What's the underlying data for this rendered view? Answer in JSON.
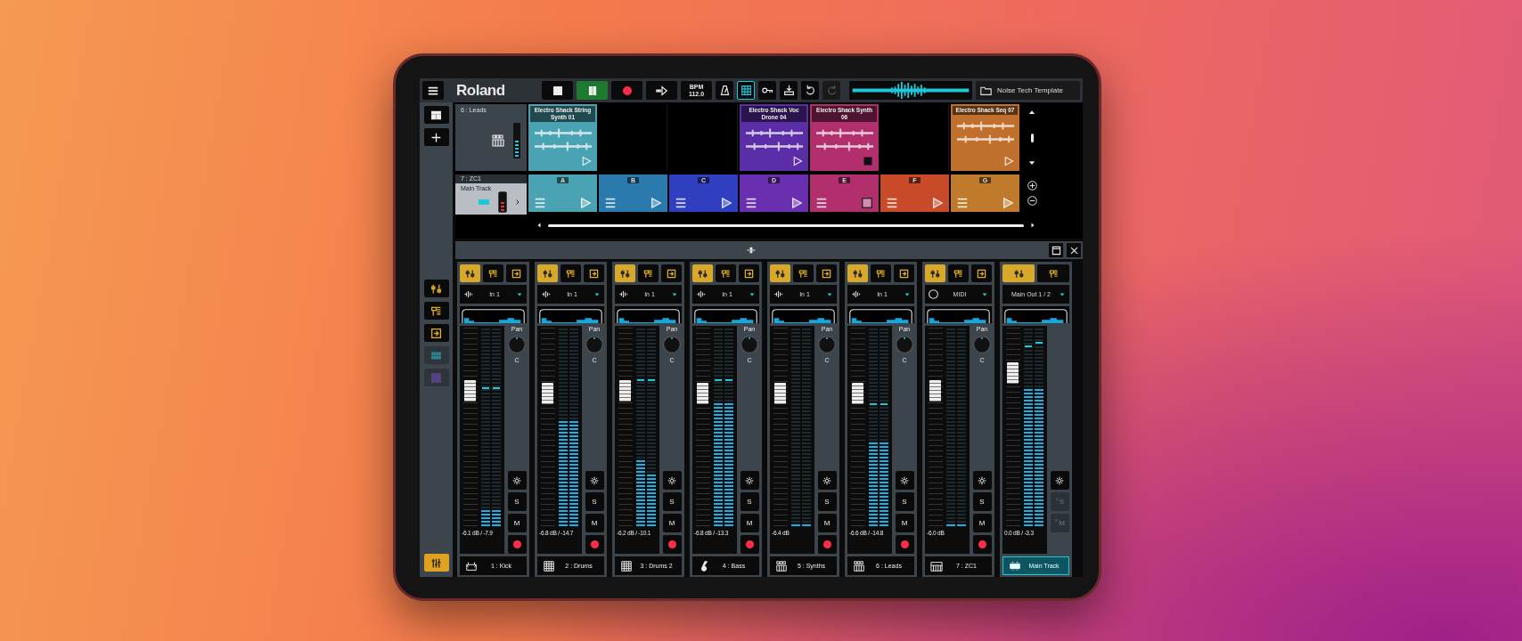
{
  "top_bar": {
    "logo": "Roland",
    "transport": [
      {
        "kind": "stop",
        "on": false
      },
      {
        "kind": "pause",
        "on": true
      },
      {
        "kind": "record",
        "on": false
      },
      {
        "kind": "step",
        "on": false
      }
    ],
    "tempo": {
      "label": "BPM",
      "value": "112.0"
    },
    "tools": [
      {
        "kind": "metronome",
        "on": false,
        "disabled": false
      },
      {
        "kind": "grid",
        "on": true,
        "disabled": false
      },
      {
        "kind": "key",
        "on": false,
        "disabled": false
      },
      {
        "kind": "export",
        "on": false,
        "disabled": false
      },
      {
        "kind": "undo",
        "on": false,
        "disabled": false
      },
      {
        "kind": "redo",
        "on": false,
        "disabled": true
      }
    ],
    "project": "Noise Tech Template"
  },
  "sidebar": {
    "tools": [
      {
        "kind": "tracks"
      },
      {
        "kind": "add"
      }
    ],
    "views": [
      {
        "kind": "fader",
        "dim": false
      },
      {
        "kind": "fx",
        "dim": false
      },
      {
        "kind": "route",
        "dim": false
      },
      {
        "kind": "pad",
        "dim": true
      },
      {
        "kind": "piano",
        "dim": true
      }
    ],
    "mixer_button": {
      "selected": true
    }
  },
  "clip_grid": {
    "clip_row": {
      "track": "6 : Leads",
      "selected": false,
      "slots": [
        {
          "kind": "clip",
          "title": "Electro Shack String Synth 01",
          "color": "#4aa3b2",
          "playing": false
        },
        {
          "kind": "empty"
        },
        {
          "kind": "empty"
        },
        {
          "kind": "clip",
          "title": "Electro Shack Voc Drone 04",
          "color": "#5b2ea8",
          "playing": false
        },
        {
          "kind": "clip",
          "title": "Electro Shack Synth 06",
          "color": "#b02f6c",
          "playing": true
        },
        {
          "kind": "empty"
        },
        {
          "kind": "clip",
          "title": "Electro Shack Seq 07",
          "color": "#c0702c",
          "playing": false
        }
      ]
    },
    "scene_row": {
      "track": "7 : ZC1",
      "name": "Main Track",
      "selected": true,
      "scenes": [
        {
          "label": "A",
          "color": "#4aa3b2",
          "playing": false
        },
        {
          "label": "B",
          "color": "#2a7aae",
          "playing": false
        },
        {
          "label": "C",
          "color": "#2f3fc0",
          "playing": false
        },
        {
          "label": "D",
          "color": "#6a2fb0",
          "playing": false
        },
        {
          "label": "E",
          "color": "#b02f6c",
          "playing": true
        },
        {
          "label": "F",
          "color": "#c84a28",
          "playing": false
        },
        {
          "label": "G",
          "color": "#c07a2c",
          "playing": false
        }
      ]
    }
  },
  "mixer": {
    "strips": [
      {
        "name": "1 : Kick",
        "selected": false,
        "tabs": [
          {
            "kind": "fader",
            "selected": true
          },
          {
            "kind": "fx",
            "selected": false
          },
          {
            "kind": "route",
            "selected": false
          }
        ],
        "input": {
          "kind": "audio",
          "label": "In 1"
        },
        "pan": {
          "label": "Pan",
          "value": "C"
        },
        "fader": {
          "level": 0.68
        },
        "meters": [
          {
            "level": 0.09,
            "peak": {
              "level": 0.69
            }
          },
          {
            "level": 0.09,
            "peak": {
              "level": 0.69
            }
          }
        ],
        "reading": "-6.1 dB / -7.9",
        "solo": {
          "label": "S",
          "disabled": false
        },
        "mute": {
          "label": "M",
          "disabled": false
        },
        "record": true
      },
      {
        "name": "2 : Drums",
        "selected": false,
        "tabs": [
          {
            "kind": "fader",
            "selected": true
          },
          {
            "kind": "fx",
            "selected": false
          },
          {
            "kind": "route",
            "selected": false
          }
        ],
        "input": {
          "kind": "audio",
          "label": "In 1"
        },
        "pan": {
          "label": "Pan",
          "value": "C"
        },
        "fader": {
          "level": 0.67
        },
        "meters": [
          {
            "level": 0.54
          },
          {
            "level": 0.54
          }
        ],
        "reading": "-6.8 dB / -14.7",
        "solo": {
          "label": "S",
          "disabled": false
        },
        "mute": {
          "label": "M",
          "disabled": false
        },
        "record": true
      },
      {
        "name": "3 : Drums 2",
        "selected": false,
        "tabs": [
          {
            "kind": "fader",
            "selected": true
          },
          {
            "kind": "fx",
            "selected": false
          },
          {
            "kind": "route",
            "selected": false
          }
        ],
        "input": {
          "kind": "audio",
          "label": "In 1"
        },
        "pan": {
          "label": "Pan",
          "value": "C"
        },
        "fader": {
          "level": 0.68
        },
        "meters": [
          {
            "level": 0.33,
            "peak": {
              "level": 0.73
            }
          },
          {
            "level": 0.27,
            "peak": {
              "level": 0.73
            }
          }
        ],
        "reading": "-6.2 dB / -10.1",
        "solo": {
          "label": "S",
          "disabled": false
        },
        "mute": {
          "label": "M",
          "disabled": false
        },
        "record": true
      },
      {
        "name": "4 : Bass",
        "selected": false,
        "tabs": [
          {
            "kind": "fader",
            "selected": true
          },
          {
            "kind": "fx",
            "selected": false
          },
          {
            "kind": "route",
            "selected": false
          }
        ],
        "input": {
          "kind": "audio",
          "label": "In 1"
        },
        "pan": {
          "label": "Pan",
          "value": "C"
        },
        "fader": {
          "level": 0.67
        },
        "meters": [
          {
            "level": 0.62,
            "peak": {
              "level": 0.73
            }
          },
          {
            "level": 0.62,
            "peak": {
              "level": 0.73
            }
          }
        ],
        "reading": "-6.8 dB / -13.3",
        "solo": {
          "label": "S",
          "disabled": false
        },
        "mute": {
          "label": "M",
          "disabled": false
        },
        "record": true
      },
      {
        "name": "5 : Synths",
        "selected": false,
        "tabs": [
          {
            "kind": "fader",
            "selected": true
          },
          {
            "kind": "fx",
            "selected": false
          },
          {
            "kind": "route",
            "selected": false
          }
        ],
        "input": {
          "kind": "audio",
          "label": "In 1"
        },
        "pan": {
          "label": "Pan",
          "value": "C"
        },
        "fader": {
          "level": 0.67
        },
        "meters": [
          {
            "level": 0
          },
          {
            "level": 0
          }
        ],
        "reading": "-6.4 dB",
        "solo": {
          "label": "S",
          "disabled": false
        },
        "mute": {
          "label": "M",
          "disabled": false
        },
        "record": true
      },
      {
        "name": "6 : Leads",
        "selected": false,
        "tabs": [
          {
            "kind": "fader",
            "selected": true
          },
          {
            "kind": "fx",
            "selected": false
          },
          {
            "kind": "route",
            "selected": false
          }
        ],
        "input": {
          "kind": "audio",
          "label": "In 1"
        },
        "pan": {
          "label": "Pan",
          "value": "C"
        },
        "fader": {
          "level": 0.67
        },
        "meters": [
          {
            "level": 0.43,
            "peak": {
              "level": 0.61
            }
          },
          {
            "level": 0.43,
            "peak": {
              "level": 0.61
            }
          }
        ],
        "reading": "-6.6 dB / -14.8",
        "solo": {
          "label": "S",
          "disabled": false
        },
        "mute": {
          "label": "M",
          "disabled": false
        },
        "record": true
      },
      {
        "name": "7 : ZC1",
        "selected": false,
        "tabs": [
          {
            "kind": "fader",
            "selected": true
          },
          {
            "kind": "fx",
            "selected": false
          },
          {
            "kind": "route",
            "selected": false
          }
        ],
        "input": {
          "kind": "midi",
          "label": "MIDI"
        },
        "pan": {
          "label": "Pan",
          "value": "C"
        },
        "fader": {
          "level": 0.68
        },
        "meters": [
          {
            "level": 0
          },
          {
            "level": 0
          }
        ],
        "reading": "-6.0 dB",
        "solo": {
          "label": "S",
          "disabled": false
        },
        "mute": {
          "label": "M",
          "disabled": false
        },
        "record": true
      },
      {
        "name": "Main Track",
        "selected": true,
        "tabs": [
          {
            "kind": "fader",
            "selected": true
          },
          {
            "kind": "fx",
            "selected": false
          }
        ],
        "input": {
          "kind": "none",
          "label": "Main Out 1 / 2"
        },
        "fader": {
          "level": 0.77
        },
        "meters": [
          {
            "level": 0.7,
            "peak": {
              "level": 0.9
            }
          },
          {
            "level": 0.7,
            "peak": {
              "level": 0.92
            }
          }
        ],
        "reading": "0.0 dB / -3.3",
        "solo": {
          "label": "S",
          "disabled": true
        },
        "mute": {
          "label": "M",
          "disabled": true
        },
        "record": false
      }
    ]
  }
}
